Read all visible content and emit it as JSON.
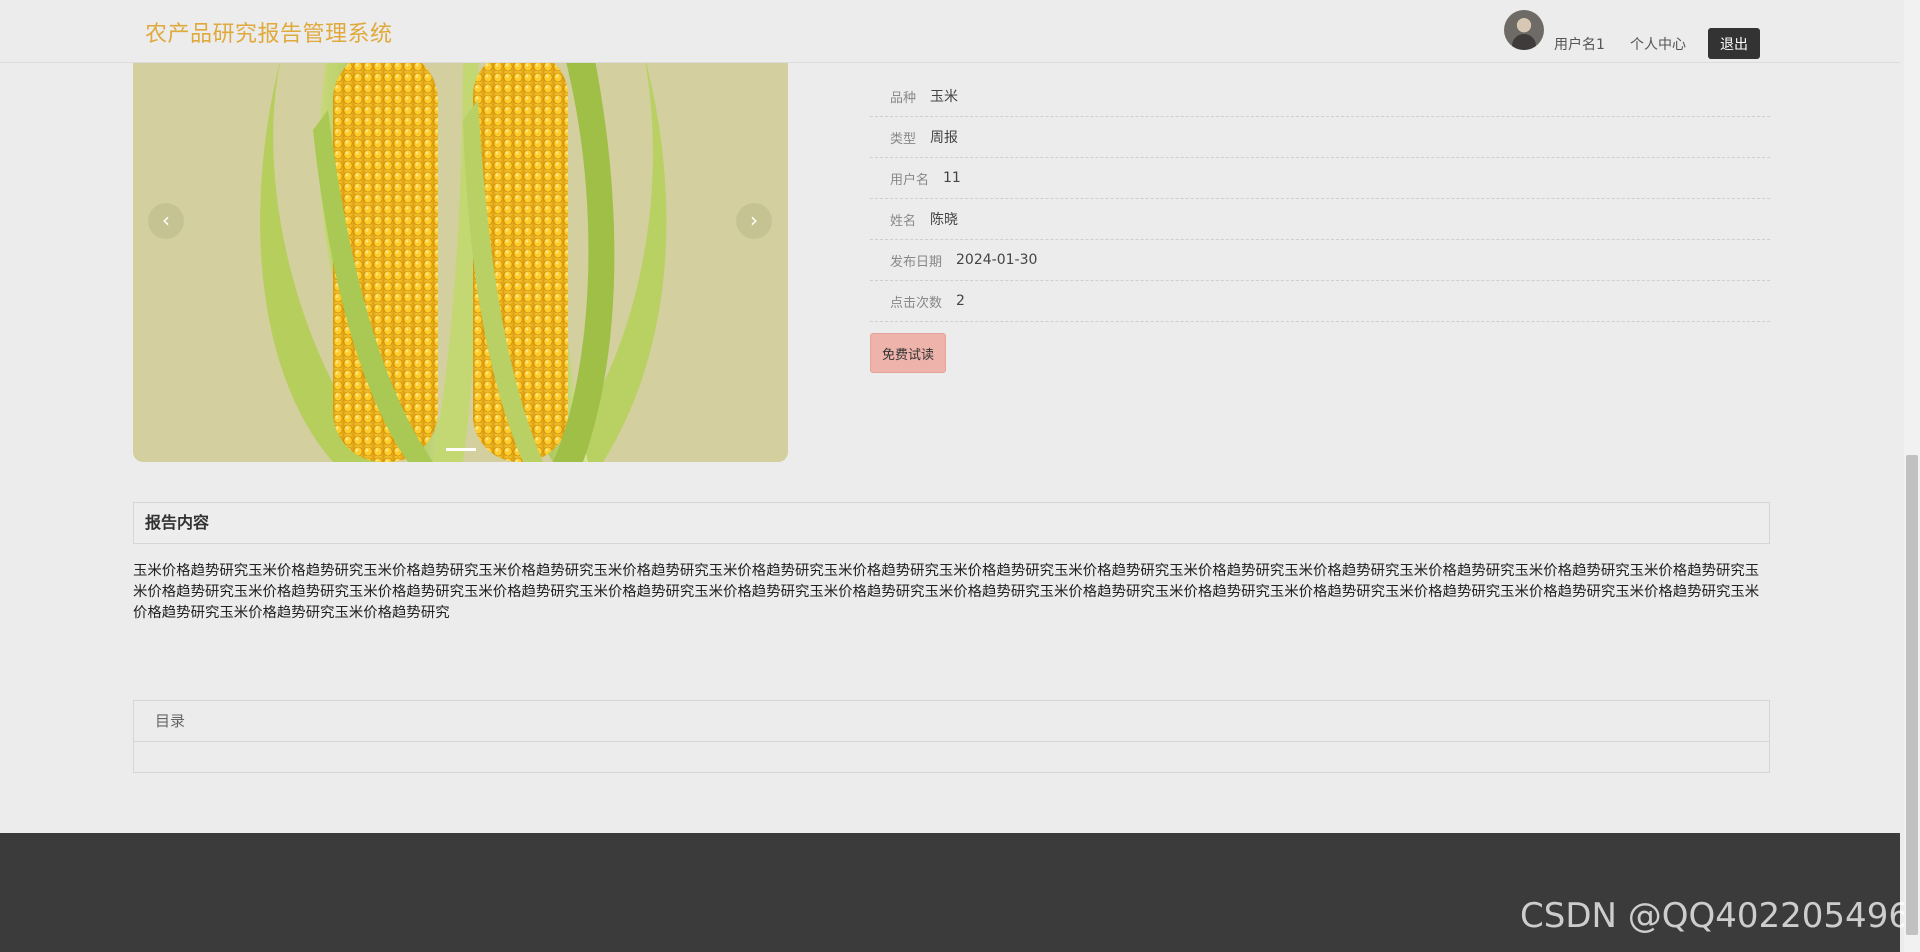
{
  "header": {
    "site_title": "农产品研究报告管理系统",
    "username_link": "用户名1",
    "profile_link": "个人中心",
    "logout_label": "退出"
  },
  "carousel": {
    "prev_glyph": "‹",
    "next_glyph": "›"
  },
  "details": [
    {
      "label": "品种",
      "value": "玉米"
    },
    {
      "label": "类型",
      "value": "周报"
    },
    {
      "label": "用户名",
      "value": "11"
    },
    {
      "label": "姓名",
      "value": "陈晓"
    },
    {
      "label": "发布日期",
      "value": "2024-01-30"
    },
    {
      "label": "点击次数",
      "value": "2"
    }
  ],
  "trial_button": "免费试读",
  "report": {
    "heading": "报告内容",
    "body": "玉米价格趋势研究玉米价格趋势研究玉米价格趋势研究玉米价格趋势研究玉米价格趋势研究玉米价格趋势研究玉米价格趋势研究玉米价格趋势研究玉米价格趋势研究玉米价格趋势研究玉米价格趋势研究玉米价格趋势研究玉米价格趋势研究玉米价格趋势研究玉米价格趋势研究玉米价格趋势研究玉米价格趋势研究玉米价格趋势研究玉米价格趋势研究玉米价格趋势研究玉米价格趋势研究玉米价格趋势研究玉米价格趋势研究玉米价格趋势研究玉米价格趋势研究玉米价格趋势研究玉米价格趋势研究玉米价格趋势研究玉米价格趋势研究玉米价格趋势研究玉米价格趋势研究"
  },
  "toc": {
    "title": "目录"
  },
  "watermark": "CSDN @QQ402205496"
}
